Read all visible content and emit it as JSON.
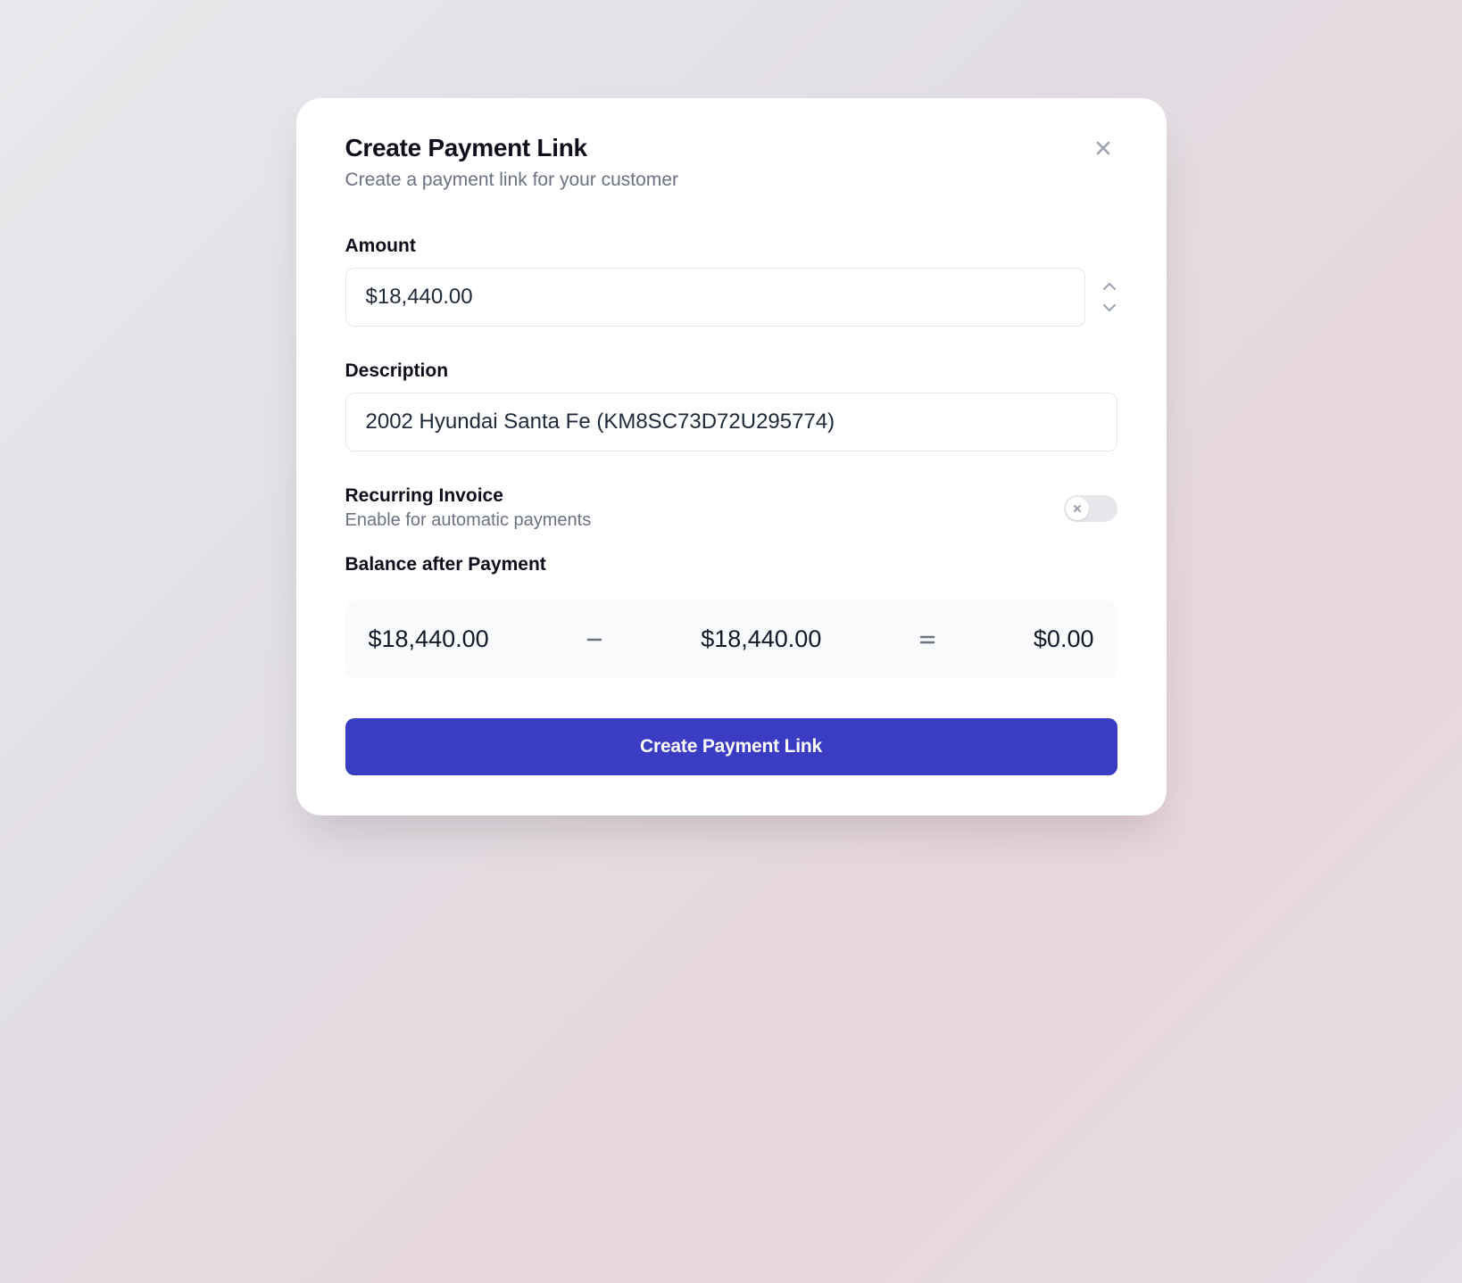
{
  "modal": {
    "title": "Create Payment Link",
    "subtitle": "Create a payment link for your customer"
  },
  "form": {
    "amount": {
      "label": "Amount",
      "value": "$18,440.00"
    },
    "description": {
      "label": "Description",
      "value": "2002 Hyundai Santa Fe (KM8SC73D72U295774)"
    },
    "recurring": {
      "title": "Recurring Invoice",
      "subtitle": "Enable for automatic payments",
      "enabled": false
    },
    "balance": {
      "label": "Balance after Payment",
      "current": "$18,440.00",
      "payment": "$18,440.00",
      "result": "$0.00"
    },
    "submit_label": "Create Payment Link"
  }
}
